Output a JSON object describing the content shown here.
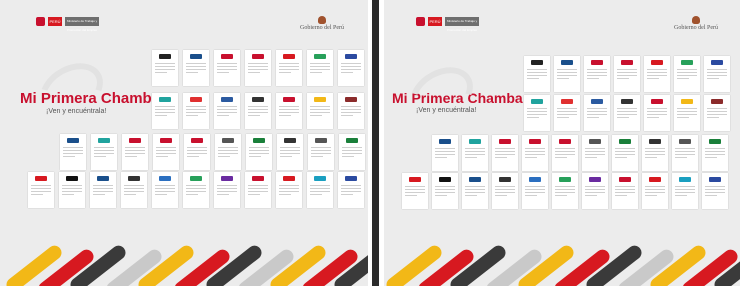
{
  "panels": [
    {
      "id": "left",
      "brand": {
        "gov_badge": "Ministerio de Trabajo y Promoción del Empleo",
        "flag_text": "PERÚ"
      },
      "gobierno": "Gobierno del Perú",
      "title": "Mi Primera Chamba",
      "subtitle": "¡Ven y encuéntrala!"
    },
    {
      "id": "right",
      "brand": {
        "gov_badge": "Ministerio de Trabajo y Promoción del Empleo",
        "flag_text": "PERÚ"
      },
      "gobierno": "Gobierno del Perú",
      "title": "Mi Primera Chamba",
      "subtitle": "¡Ven y encuéntrala!"
    }
  ],
  "colors": {
    "brand_red": "#c8102e",
    "background": "#ececec",
    "card": "#ffffff",
    "divider": "#2b2b2b",
    "stripe_palette": [
      "#f2b817",
      "#d71920",
      "#3a3a3a",
      "#c9c9c9"
    ]
  },
  "company_cards": {
    "rows": 4,
    "row_counts": [
      7,
      7,
      10,
      11
    ],
    "logo_colors": [
      [
        "#222222",
        "#1a4f8b",
        "#c8102e",
        "#c8102e",
        "#d71920",
        "#27a05a",
        "#2b4aa0"
      ],
      [
        "#20a39e",
        "#e03030",
        "#2b5aa0",
        "#333333",
        "#c8102e",
        "#f2b817",
        "#8b2b2b"
      ],
      [
        "#1a4f8b",
        "#20a39e",
        "#c8102e",
        "#c8102e",
        "#c8102e",
        "#555555",
        "#1a7f3a",
        "#333333",
        "#555555",
        "#1a7f3a"
      ],
      [
        "#d71920",
        "#111111",
        "#1a4f8b",
        "#333333",
        "#2b6fc0",
        "#27a05a",
        "#6a2ba0",
        "#c8102e",
        "#d71920",
        "#1a9fc0",
        "#2b4aa0"
      ]
    ]
  }
}
